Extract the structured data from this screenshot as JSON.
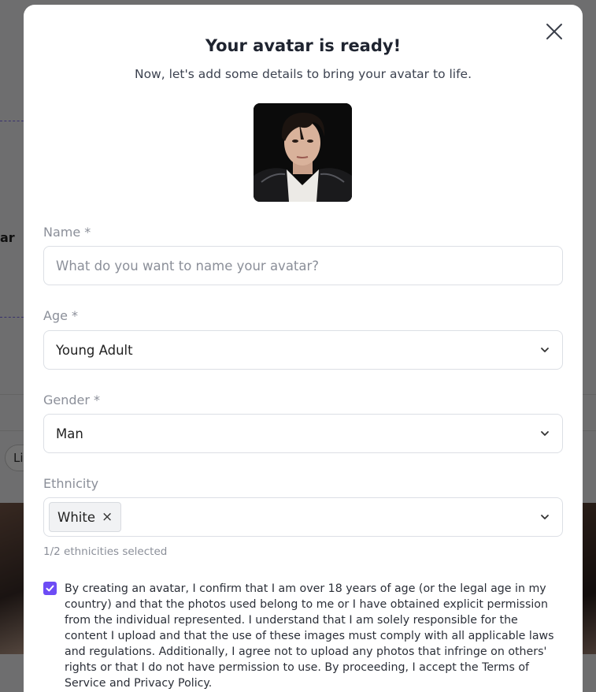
{
  "background": {
    "partial_label": "ar",
    "partial_pill": "Li"
  },
  "modal": {
    "title": "Your avatar is ready!",
    "subtitle": "Now, let's add some details to bring your avatar to life.",
    "close_icon": "close-icon"
  },
  "form": {
    "name": {
      "label": "Name *",
      "placeholder": "What do you want to name your avatar?",
      "value": ""
    },
    "age": {
      "label": "Age *",
      "value": "Young Adult"
    },
    "gender": {
      "label": "Gender *",
      "value": "Man"
    },
    "ethnicity": {
      "label": "Ethnicity",
      "tags": [
        "White"
      ],
      "remove_glyph": "×",
      "helper": "1/2 ethnicities selected"
    },
    "consent": {
      "checked": true,
      "text": "By creating an avatar, I confirm that I am over 18 years of age (or the legal age in my country) and that the photos used belong to me or I have obtained explicit permission from the individual represented. I understand that I am solely responsible for the content I upload and that the use of these images must comply with all applicable laws and regulations. Additionally, I agree not to upload any photos that infringe on others' rights or that I do not have permission to use. By proceeding, I accept the Terms of Service and Privacy Policy."
    }
  },
  "colors": {
    "accent": "#6d4cf5",
    "overlay": "#8c8c8c"
  }
}
